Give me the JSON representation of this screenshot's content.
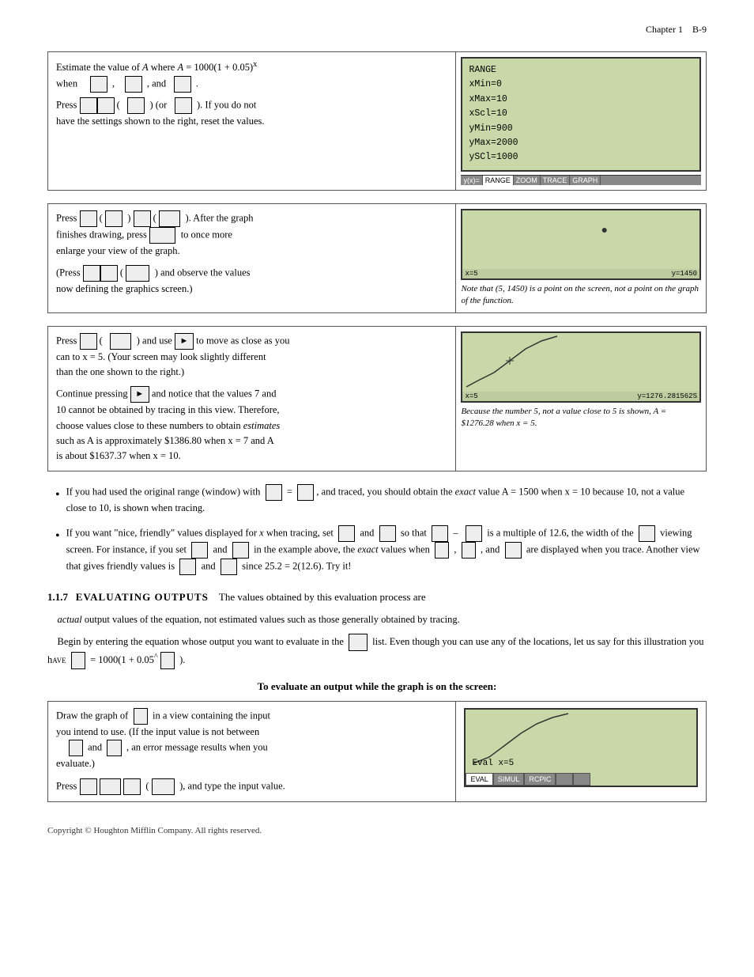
{
  "header": {
    "chapter": "Chapter 1",
    "page": "B-9"
  },
  "section1": {
    "text1": "Estimate the value of A where A = 1000(1 + 0.05)",
    "exponent": "x",
    "text2": "when",
    "comma1": ",",
    "comma2": ", and",
    "period": ".",
    "press_text": "Press",
    "or_text": ") (or",
    "paren_close": "). If you do not",
    "text3": "have the settings shown to the right, reset the values.",
    "range_label": "RANGE",
    "range_xmin": "xMin=0",
    "range_xmax": "xMax=10",
    "range_xscl": "xScl=10",
    "range_ymin": "yMin=900",
    "range_ymax": "yMax=2000",
    "range_yscl": "ySCl=1000",
    "menu_items": [
      "y(x)=",
      "RANGE",
      "ZOOM",
      "TRACE",
      "GRAPH"
    ]
  },
  "section2": {
    "text1": "Press",
    "paren1": "(",
    "paren2": "(",
    "text2": "). After the graph",
    "text3": "finishes drawing, press",
    "text4": "to once more",
    "text5": "enlarge your view of the graph.",
    "text6": "(Press",
    "paren3": "(",
    "text7": ") and observe the values",
    "text8": "now defining the graphics screen.)",
    "note": "Note that (5, 1450) is a point on the screen, not a point on the graph of the function.",
    "coord_x": "x=5",
    "coord_y": "y=1450"
  },
  "section3": {
    "text1": "Press",
    "paren1": "(",
    "text2": ") and use",
    "text3": "to move as close as you",
    "text4": "can to x = 5.  (Your screen may look slightly different",
    "text5": "than the one shown to the right.)",
    "text6": "Continue pressing",
    "text7": "and notice that the values 7 and",
    "text8": "10 cannot be obtained by tracing in this view.  Therefore,",
    "text9": "choose values close to these numbers to obtain",
    "text9_italic": "estimates",
    "text10": "such as  A is approximately $1386.80 when x = 7 and A",
    "text11": "is about $1637.37 when x = 10.",
    "note1": "Because the number 5,",
    "note1_italic": "not",
    "note2": "a value close to 5 is shown,",
    "note3": "A = $1276.28 when x = 5.",
    "coord_x": "x=5",
    "coord_y": "y=1276.281562S"
  },
  "bullets": [
    {
      "text": "If you had used the original range (window) with      =   , and traced, you should obtain the exact value A = 1500 when x = 10 because 10, not a value close to 10, is shown when tracing."
    },
    {
      "text": "If you want “nice, friendly” values displayed for x when tracing, set      and      so that      –       is a multiple of 12.6, the width of the        viewing screen.  For instance, if you set        and        in the example above, the exact values when       ,     , and        are displayed when you trace.  Another view that gives friendly values is        and        since 25.2 = 2(12.6).  Try it!"
    }
  ],
  "section_117": {
    "number": "1.1.7",
    "title": "EVALUATING OUTPUTS",
    "text1": "The values obtained by this evaluation process are actual output values of the equation, not estimated values such as those generally obtained by tracing.",
    "text2": "Begin by entering the equation whose output you want to evaluate in the        list. Even though you can use any of the locations, let us say for this illustration you have     = 1000(1 + 0.05^    )."
  },
  "sub_heading": "To evaluate an output while the graph is on the screen:",
  "bottom_section": {
    "text1": "Draw the graph of     in a view containing the input",
    "text2": "you intend to use.  (If the input value is not between",
    "text3": "     and      , an error message results when you",
    "text4": "evaluate.)",
    "press_text": "Press",
    "text5": "), and type the input value.",
    "eval_text": "Eval x=5",
    "menu_items": [
      "EVAL",
      "SIMUL",
      "RCPIC"
    ]
  },
  "footer": {
    "text": "Copyright © Houghton Mifflin Company.  All rights reserved."
  }
}
